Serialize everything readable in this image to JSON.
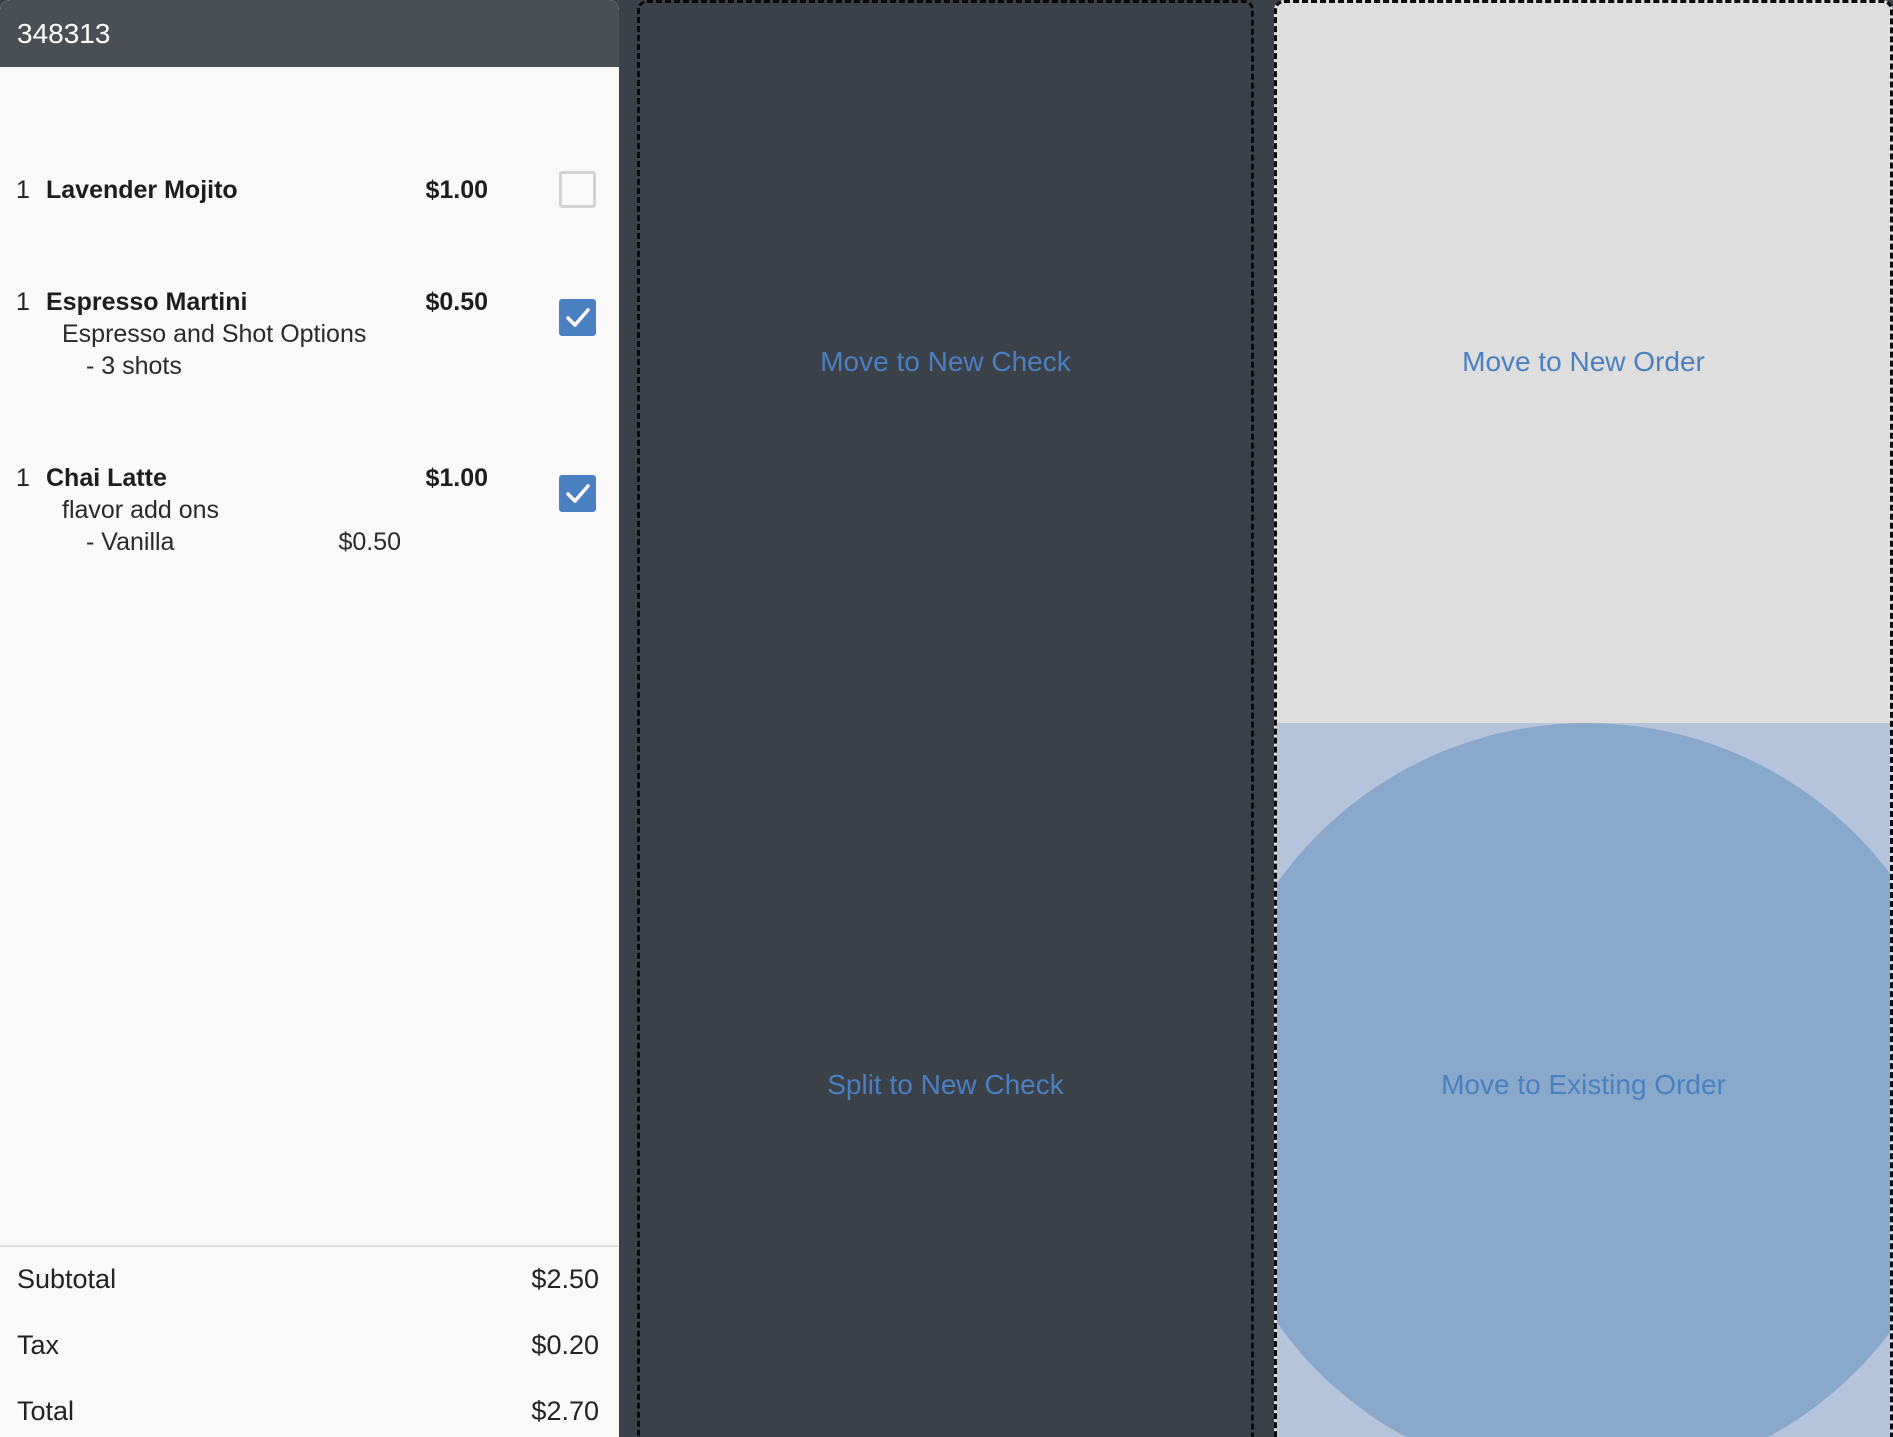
{
  "order": {
    "id": "348313",
    "items": [
      {
        "qty": "1",
        "name": "Lavender Mojito",
        "price": "$1.00",
        "checked": false,
        "modifiers": []
      },
      {
        "qty": "1",
        "name": "Espresso Martini",
        "price": "$0.50",
        "checked": true,
        "modifiers": [
          {
            "group": "Espresso and Shot Options",
            "option": "- 3 shots",
            "price": ""
          }
        ]
      },
      {
        "qty": "1",
        "name": "Chai Latte",
        "price": "$1.00",
        "checked": true,
        "modifiers": [
          {
            "group": "flavor add ons",
            "option": "- Vanilla",
            "price": "$0.50"
          }
        ]
      }
    ],
    "totals": {
      "subtotal_label": "Subtotal",
      "subtotal_value": "$2.50",
      "tax_label": "Tax",
      "tax_value": "$0.20",
      "total_label": "Total",
      "total_value": "$2.70"
    }
  },
  "actions": {
    "move_new_check": "Move to New Check",
    "split_new_check": "Split to New Check",
    "move_new_order": "Move to New Order",
    "move_existing_order": "Move to Existing Order"
  },
  "colors": {
    "accent": "#4a80c2",
    "header_bg": "#4a4f56",
    "dark_bg": "#3b4148",
    "light_zone": "#dedede",
    "highlight_zone": "#8aa8c9"
  },
  "icons": {
    "checkbox_checked": "checkmark-icon"
  }
}
